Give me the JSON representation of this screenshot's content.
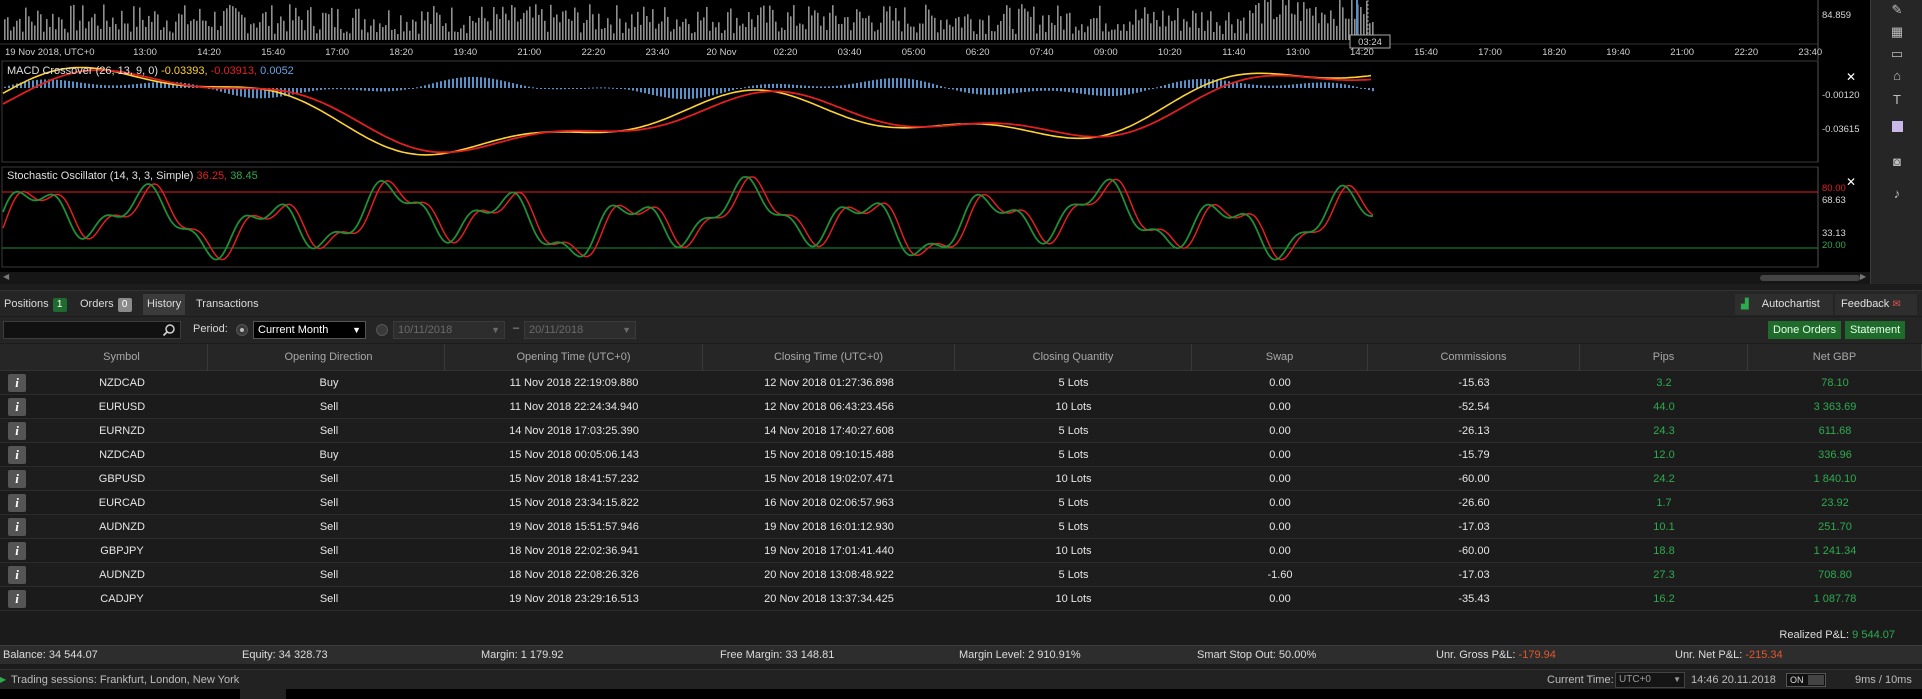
{
  "chart": {
    "time_ticks": [
      "19 Nov 2018, UTC+0",
      "13:00",
      "14:20",
      "15:40",
      "17:00",
      "18:20",
      "19:40",
      "21:00",
      "22:20",
      "23:40",
      "20 Nov",
      "02:20",
      "03:40",
      "05:00",
      "06:20",
      "07:40",
      "09:00",
      "10:20",
      "11:40",
      "13:00",
      "14:20",
      "15:40",
      "17:00",
      "18:20",
      "19:40",
      "21:00",
      "22:20",
      "23:40"
    ],
    "cursor_time": "03:24",
    "volume_price_label": "84.859",
    "macd": {
      "label": "MACD Crossover (26, 13, 9, 0)",
      "v1": "-0.03393,",
      "v2": "-0.03913,",
      "v3": "0.0052",
      "price_labels": [
        "-0.00120",
        "-0.03615"
      ]
    },
    "stoch": {
      "label": "Stochastic Oscillator (14, 3, 3, Simple)",
      "v1": "36.25,",
      "v2": "38.45",
      "price_labels": [
        "80.00",
        "68.63",
        "33.13",
        "20.00"
      ]
    },
    "colors": {
      "red": "#e02020",
      "yellow": "#ffd233",
      "green": "#1f8f35",
      "histogram": "#5a8fc8"
    }
  },
  "tabs": {
    "positions": {
      "label": "Positions",
      "count": "1"
    },
    "orders": {
      "label": "Orders",
      "count": "0"
    },
    "history": {
      "label": "History"
    },
    "transactions": {
      "label": "Transactions"
    },
    "autochartist": "Autochartist",
    "feedback": "Feedback"
  },
  "filter": {
    "search_value": "",
    "period_label": "Period:",
    "period_value": "Current Month",
    "date_from": "10/11/2018",
    "date_to": "20/11/2018",
    "done_orders": "Done Orders",
    "statement": "Statement"
  },
  "table": {
    "columns": [
      "Symbol",
      "Opening Direction",
      "Opening Time (UTC+0)",
      "Closing Time (UTC+0)",
      "Closing Quantity",
      "Swap",
      "Commissions",
      "Pips",
      "Net GBP"
    ],
    "rows": [
      [
        "NZDCAD",
        "Buy",
        "11 Nov 2018 22:19:09.880",
        "12 Nov 2018 01:27:36.898",
        "5 Lots",
        "0.00",
        "-15.63",
        "3.2",
        "78.10"
      ],
      [
        "EURUSD",
        "Sell",
        "11 Nov 2018 22:24:34.940",
        "12 Nov 2018 06:43:23.456",
        "10 Lots",
        "0.00",
        "-52.54",
        "44.0",
        "3 363.69"
      ],
      [
        "EURNZD",
        "Sell",
        "14 Nov 2018 17:03:25.390",
        "14 Nov 2018 17:40:27.608",
        "5 Lots",
        "0.00",
        "-26.13",
        "24.3",
        "611.68"
      ],
      [
        "NZDCAD",
        "Buy",
        "15 Nov 2018 00:05:06.143",
        "15 Nov 2018 09:10:15.488",
        "5 Lots",
        "0.00",
        "-15.79",
        "12.0",
        "336.96"
      ],
      [
        "GBPUSD",
        "Sell",
        "15 Nov 2018 18:41:57.232",
        "15 Nov 2018 19:02:07.471",
        "10 Lots",
        "0.00",
        "-60.00",
        "24.2",
        "1 840.10"
      ],
      [
        "EURCAD",
        "Sell",
        "15 Nov 2018 23:34:15.822",
        "16 Nov 2018 02:06:57.963",
        "5 Lots",
        "0.00",
        "-26.60",
        "1.7",
        "23.92"
      ],
      [
        "AUDNZD",
        "Sell",
        "19 Nov 2018 15:51:57.946",
        "19 Nov 2018 16:01:12.930",
        "5 Lots",
        "0.00",
        "-17.03",
        "10.1",
        "251.70"
      ],
      [
        "GBPJPY",
        "Sell",
        "18 Nov 2018 22:02:36.941",
        "19 Nov 2018 17:01:41.440",
        "10 Lots",
        "0.00",
        "-60.00",
        "18.8",
        "1 241.34"
      ],
      [
        "AUDNZD",
        "Sell",
        "18 Nov 2018 22:08:26.326",
        "20 Nov 2018 13:08:48.922",
        "5 Lots",
        "-1.60",
        "-17.03",
        "27.3",
        "708.80"
      ],
      [
        "CADJPY",
        "Sell",
        "19 Nov 2018 23:29:16.513",
        "20 Nov 2018 13:37:34.425",
        "10 Lots",
        "0.00",
        "-35.43",
        "16.2",
        "1 087.78"
      ]
    ],
    "realized_label": "Realized P&L:",
    "realized_value": "9 544.07"
  },
  "account": {
    "balance": "Balance: 34 544.07",
    "equity": "Equity: 34 328.73",
    "margin": "Margin: 1 179.92",
    "free_margin": "Free Margin: 33 148.81",
    "margin_level": "Margin Level: 2 910.91%",
    "smart_stop": "Smart Stop Out: 50.00%",
    "unr_gross_label": "Unr. Gross P&L:",
    "unr_gross_value": "-179.94",
    "unr_net_label": "Unr. Net P&L:",
    "unr_net_value": "-215.34"
  },
  "status": {
    "sessions": "Trading sessions: Frankfurt, London, New York",
    "current_time_label": "Current Time:",
    "timezone": "UTC+0",
    "time_value": "14:46 20.11.2018",
    "toggle": "ON",
    "latency": "9ms / 10ms"
  }
}
